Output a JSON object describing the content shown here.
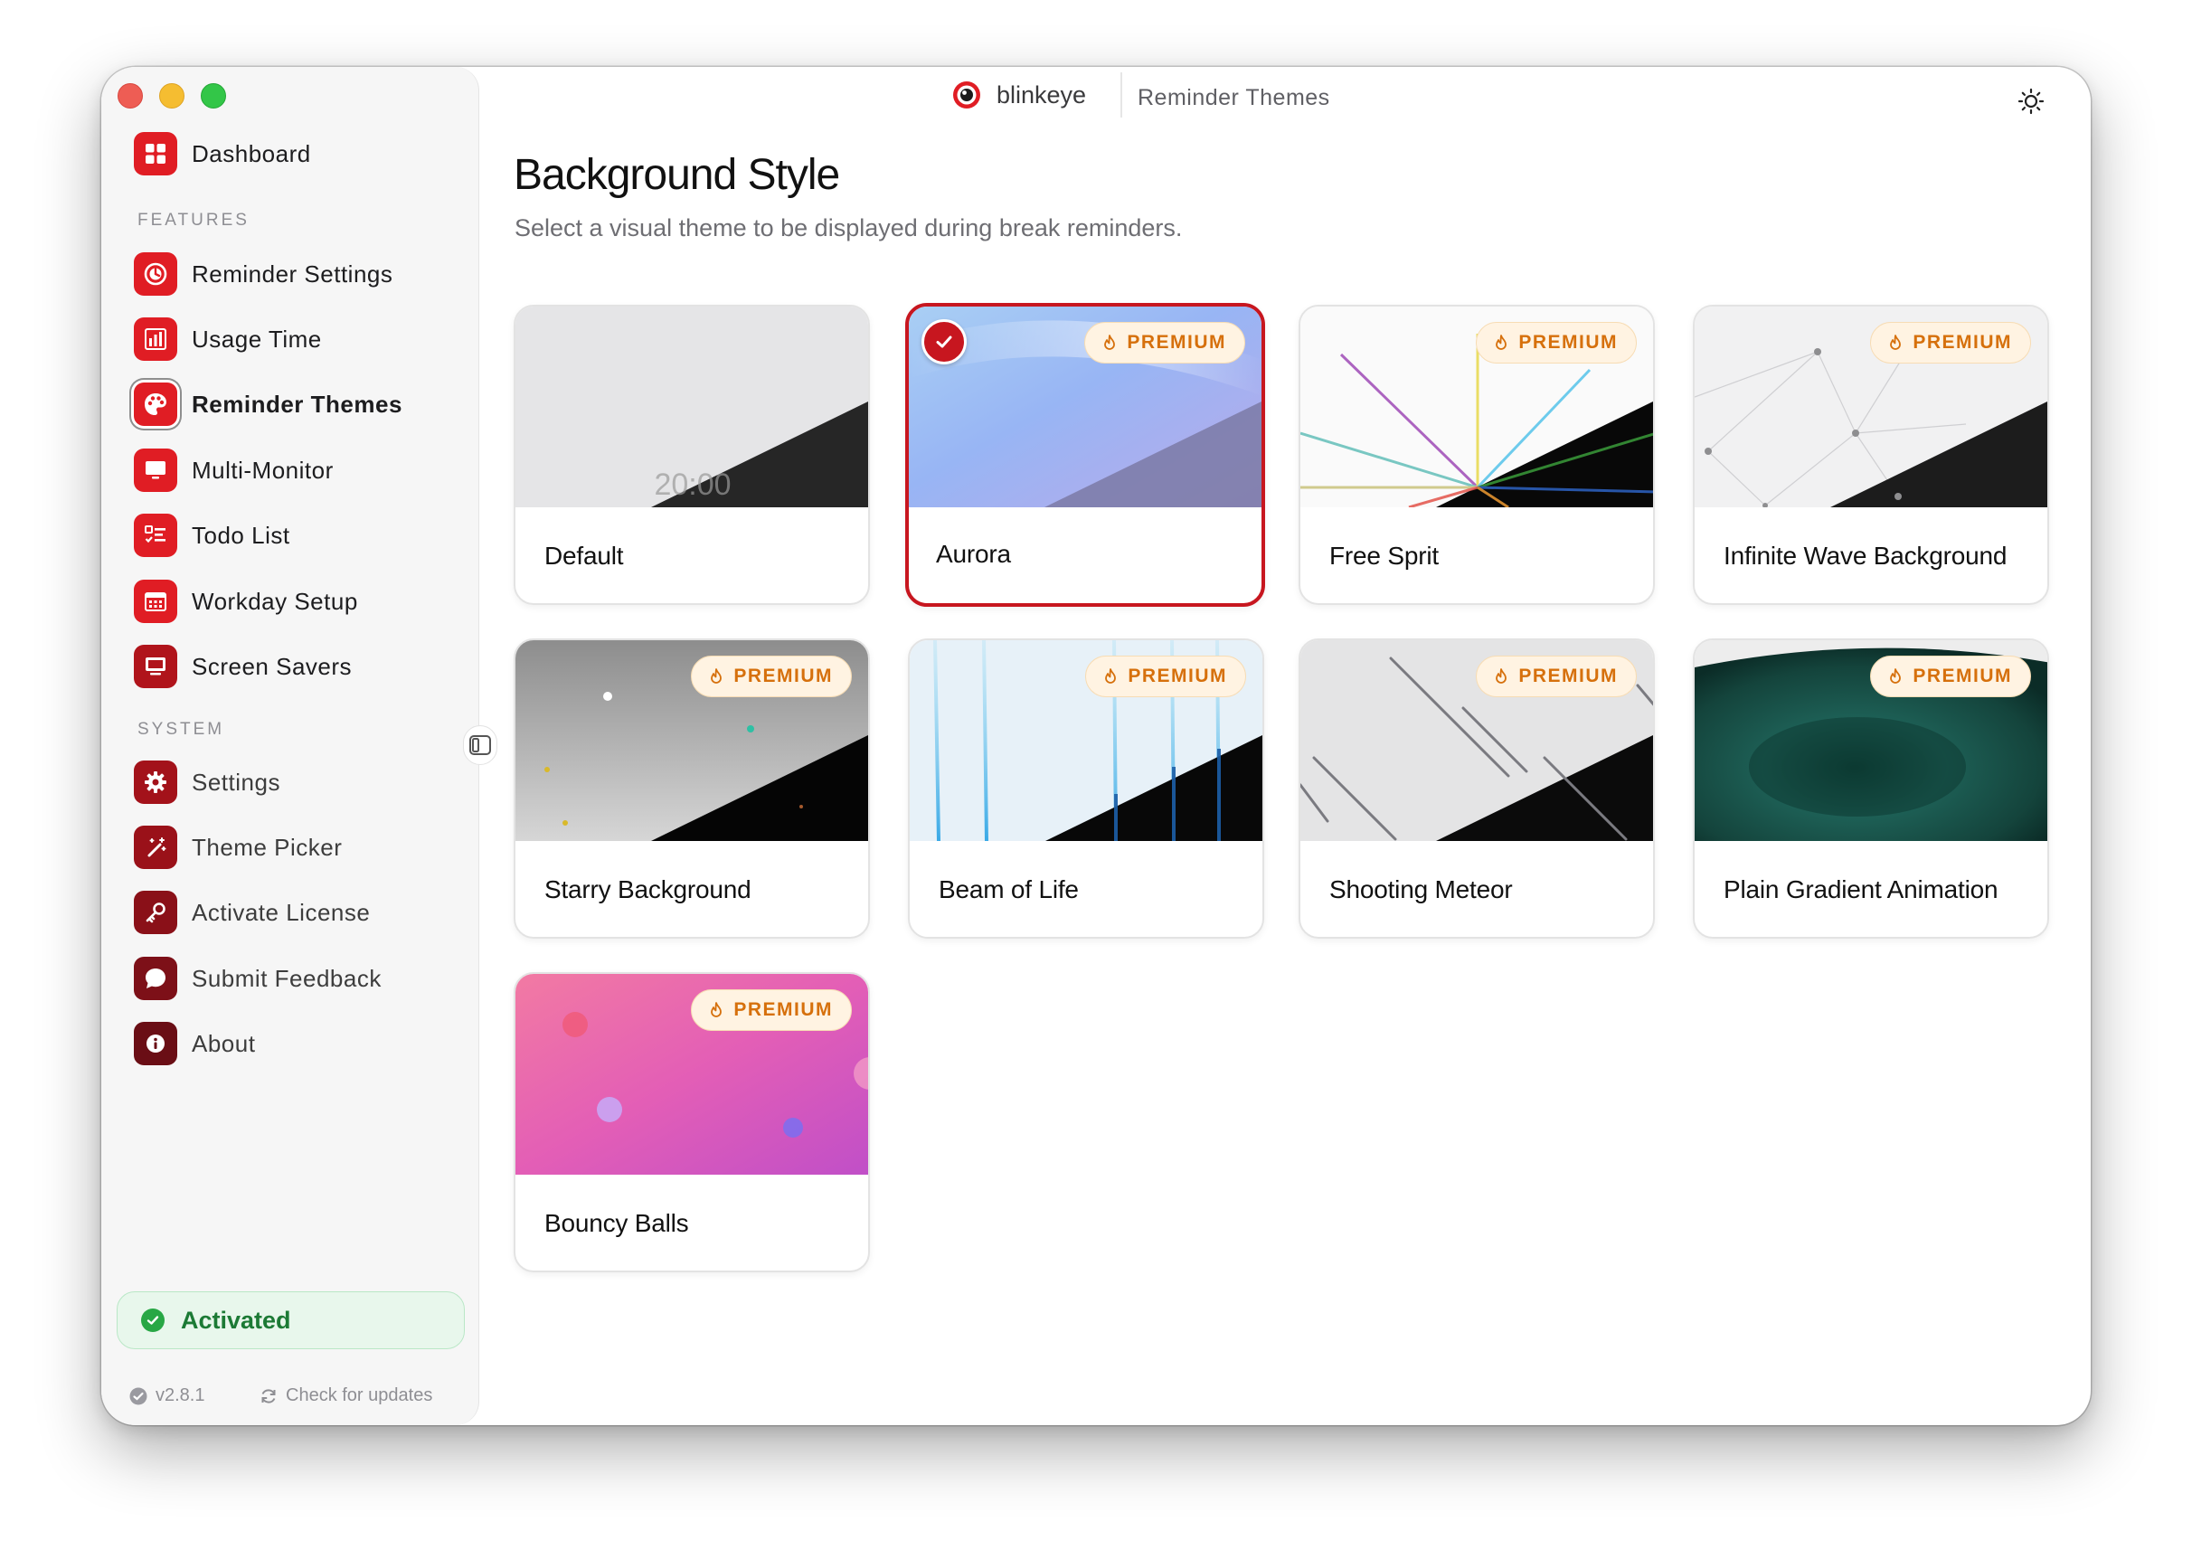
{
  "app": {
    "name": "blinkeye",
    "page": "Reminder Themes"
  },
  "sidebar": {
    "dashboard": {
      "label": "Dashboard",
      "icon": "dashboard-icon"
    },
    "features_label": "FEATURES",
    "features": [
      {
        "label": "Reminder Settings",
        "icon": "timer-icon"
      },
      {
        "label": "Usage Time",
        "icon": "bar-chart-icon"
      },
      {
        "label": "Reminder Themes",
        "icon": "palette-icon",
        "active": true
      },
      {
        "label": "Multi-Monitor",
        "icon": "monitor-icon"
      },
      {
        "label": "Todo List",
        "icon": "checklist-icon"
      },
      {
        "label": "Workday Setup",
        "icon": "calendar-icon"
      },
      {
        "label": "Screen Savers",
        "icon": "screen-icon"
      }
    ],
    "system_label": "SYSTEM",
    "system": [
      {
        "label": "Settings",
        "icon": "gear-icon"
      },
      {
        "label": "Theme Picker",
        "icon": "magic-wand-icon"
      },
      {
        "label": "Activate License",
        "icon": "key-icon"
      },
      {
        "label": "Submit Feedback",
        "icon": "chat-bubble-icon"
      },
      {
        "label": "About",
        "icon": "info-icon"
      }
    ],
    "status": "Activated",
    "version": "v2.8.1",
    "check_updates": "Check for updates"
  },
  "main": {
    "title": "Background Style",
    "subtitle": "Select a visual theme to be displayed during break reminders.",
    "premium_label": "PREMIUM",
    "themes": [
      {
        "name": "Default",
        "premium": false,
        "selected": false,
        "preview_text": "20:00"
      },
      {
        "name": "Aurora",
        "premium": true,
        "selected": true
      },
      {
        "name": "Free Sprit",
        "premium": true,
        "selected": false
      },
      {
        "name": "Infinite Wave Background",
        "premium": true,
        "selected": false
      },
      {
        "name": "Starry Background",
        "premium": true,
        "selected": false
      },
      {
        "name": "Beam of Life",
        "premium": true,
        "selected": false
      },
      {
        "name": "Shooting Meteor",
        "premium": true,
        "selected": false
      },
      {
        "name": "Plain Gradient Animation",
        "premium": true,
        "selected": false
      },
      {
        "name": "Bouncy Balls",
        "premium": true,
        "selected": false
      }
    ]
  },
  "colors": {
    "accent": "#c7161f",
    "premium": "#d6700c",
    "activated": "#1c7a35"
  }
}
